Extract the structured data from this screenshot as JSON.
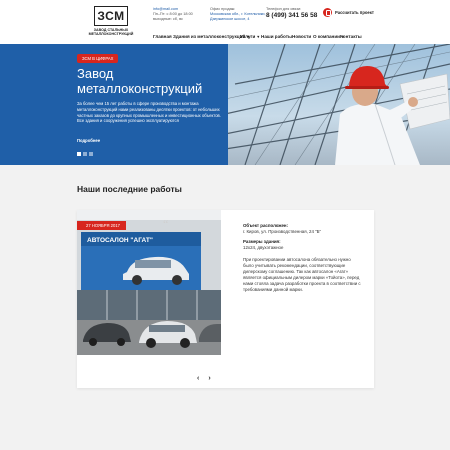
{
  "header": {
    "logo_mark": "ЗСМ",
    "logo_text": "ЗАВОД СТАЛЬНЫХ МЕТАЛЛОКОНСТРУКЦИЙ",
    "email": "info@mail.com",
    "hours": "Пн–Пт: с 8:00 до 18:00",
    "hours2": "выходные: сб, вс",
    "office_label": "Офис продаж:",
    "office_addr": "Московская обл., г. Котельники, Дзержинское шоссе, 4",
    "phone_label": "Телефон для связи:",
    "phone": "8 (499) 341 56 58",
    "callback": "Рассчитать проект"
  },
  "nav": [
    {
      "label": "Главная",
      "caret": false
    },
    {
      "label": "Здания из металлоконструкций",
      "caret": true
    },
    {
      "label": "Услуги",
      "caret": true
    },
    {
      "label": "Наши работы",
      "caret": false
    },
    {
      "label": "Новости",
      "caret": false
    },
    {
      "label": "О компании",
      "caret": true
    },
    {
      "label": "Контакты",
      "caret": false
    }
  ],
  "hero": {
    "badge": "ЗСМ В ЦИФРАХ",
    "title": "Завод металлоконструкций",
    "description": "За более чем 15 лет работы в сфере производства и монтажа металлоконструкций нами реализованы десятки проектов: от небольших частных заказов до крупных промышленных и инвестиционных объектов. Все здания и сооружения успешно эксплуатируются",
    "more": "Подробнее"
  },
  "works": {
    "title": "Наши последние работы",
    "card": {
      "date": "27 НОЯБРЯ 2017",
      "sign": "АВТОСАЛОН \"АГАТ\"",
      "object_label": "Объект расположен:",
      "object_value": "г. Киров, ул. Производственная, 24 \"Б\"",
      "size_label": "Размеры здания:",
      "size_value": "12х24, двухэтажное",
      "text": "При проектировании автосалона обязательно нужно было учитывать рекомендации, соответствующие дилерскому соглашению. Так как автосалон «Агат» является официальным дилером марки «Тойота», перед нами стояла задача разработки проекта в соответствии с требованиями данной марки."
    },
    "prev": "‹",
    "next": "›"
  }
}
